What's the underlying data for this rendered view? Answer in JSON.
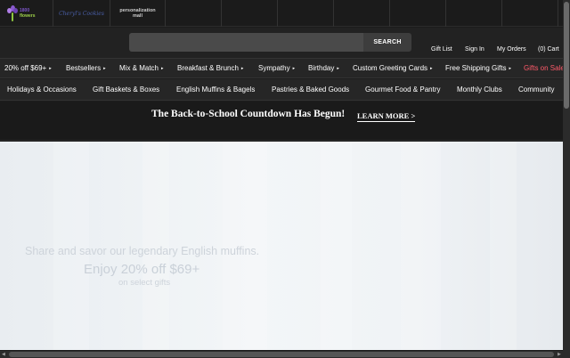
{
  "brands": {
    "logo_1800_top": "1800",
    "logo_1800_bottom": "flowers",
    "logo_cheryls": "Cheryl's Cookies",
    "logo_pmall_line1": "personalization",
    "logo_pmall_line2": "mall"
  },
  "header": {
    "search_placeholder": "",
    "search_label": "SEARCH",
    "gift_list": "Gift List",
    "sign_in": "Sign In",
    "my_orders": "My Orders",
    "cart": "(0) Cart"
  },
  "nav_primary": [
    {
      "label": "20% off $69+",
      "caret": "▸"
    },
    {
      "label": "Bestsellers",
      "caret": "▸"
    },
    {
      "label": "Mix & Match",
      "caret": "▸"
    },
    {
      "label": "Breakfast & Brunch",
      "caret": "▸"
    },
    {
      "label": "Sympathy",
      "caret": "▸"
    },
    {
      "label": "Birthday",
      "caret": "▸"
    },
    {
      "label": "Custom Greeting Cards",
      "caret": "▸"
    },
    {
      "label": "Free Shipping Gifts",
      "caret": "▸"
    },
    {
      "label": "Gifts on Sale",
      "caret": ""
    }
  ],
  "nav_secondary": [
    {
      "label": "Holidays & Occasions"
    },
    {
      "label": "Gift Baskets & Boxes"
    },
    {
      "label": "English Muffins & Bagels"
    },
    {
      "label": "Pastries & Baked Goods"
    },
    {
      "label": "Gourmet Food & Pantry"
    },
    {
      "label": "Monthly Clubs"
    },
    {
      "label": "Community"
    }
  ],
  "promo": {
    "headline": "The Back-to-School Countdown Has Begun!",
    "link": "LEARN MORE >"
  },
  "hero": {
    "line1": "Share and savor our legendary English muffins.",
    "line2": "Enjoy 20% off $69+",
    "line3": "on select gifts"
  },
  "colors": {
    "sale": "#ff5a6a",
    "background": "#1c1c1c",
    "hero": "#eef2f5"
  }
}
